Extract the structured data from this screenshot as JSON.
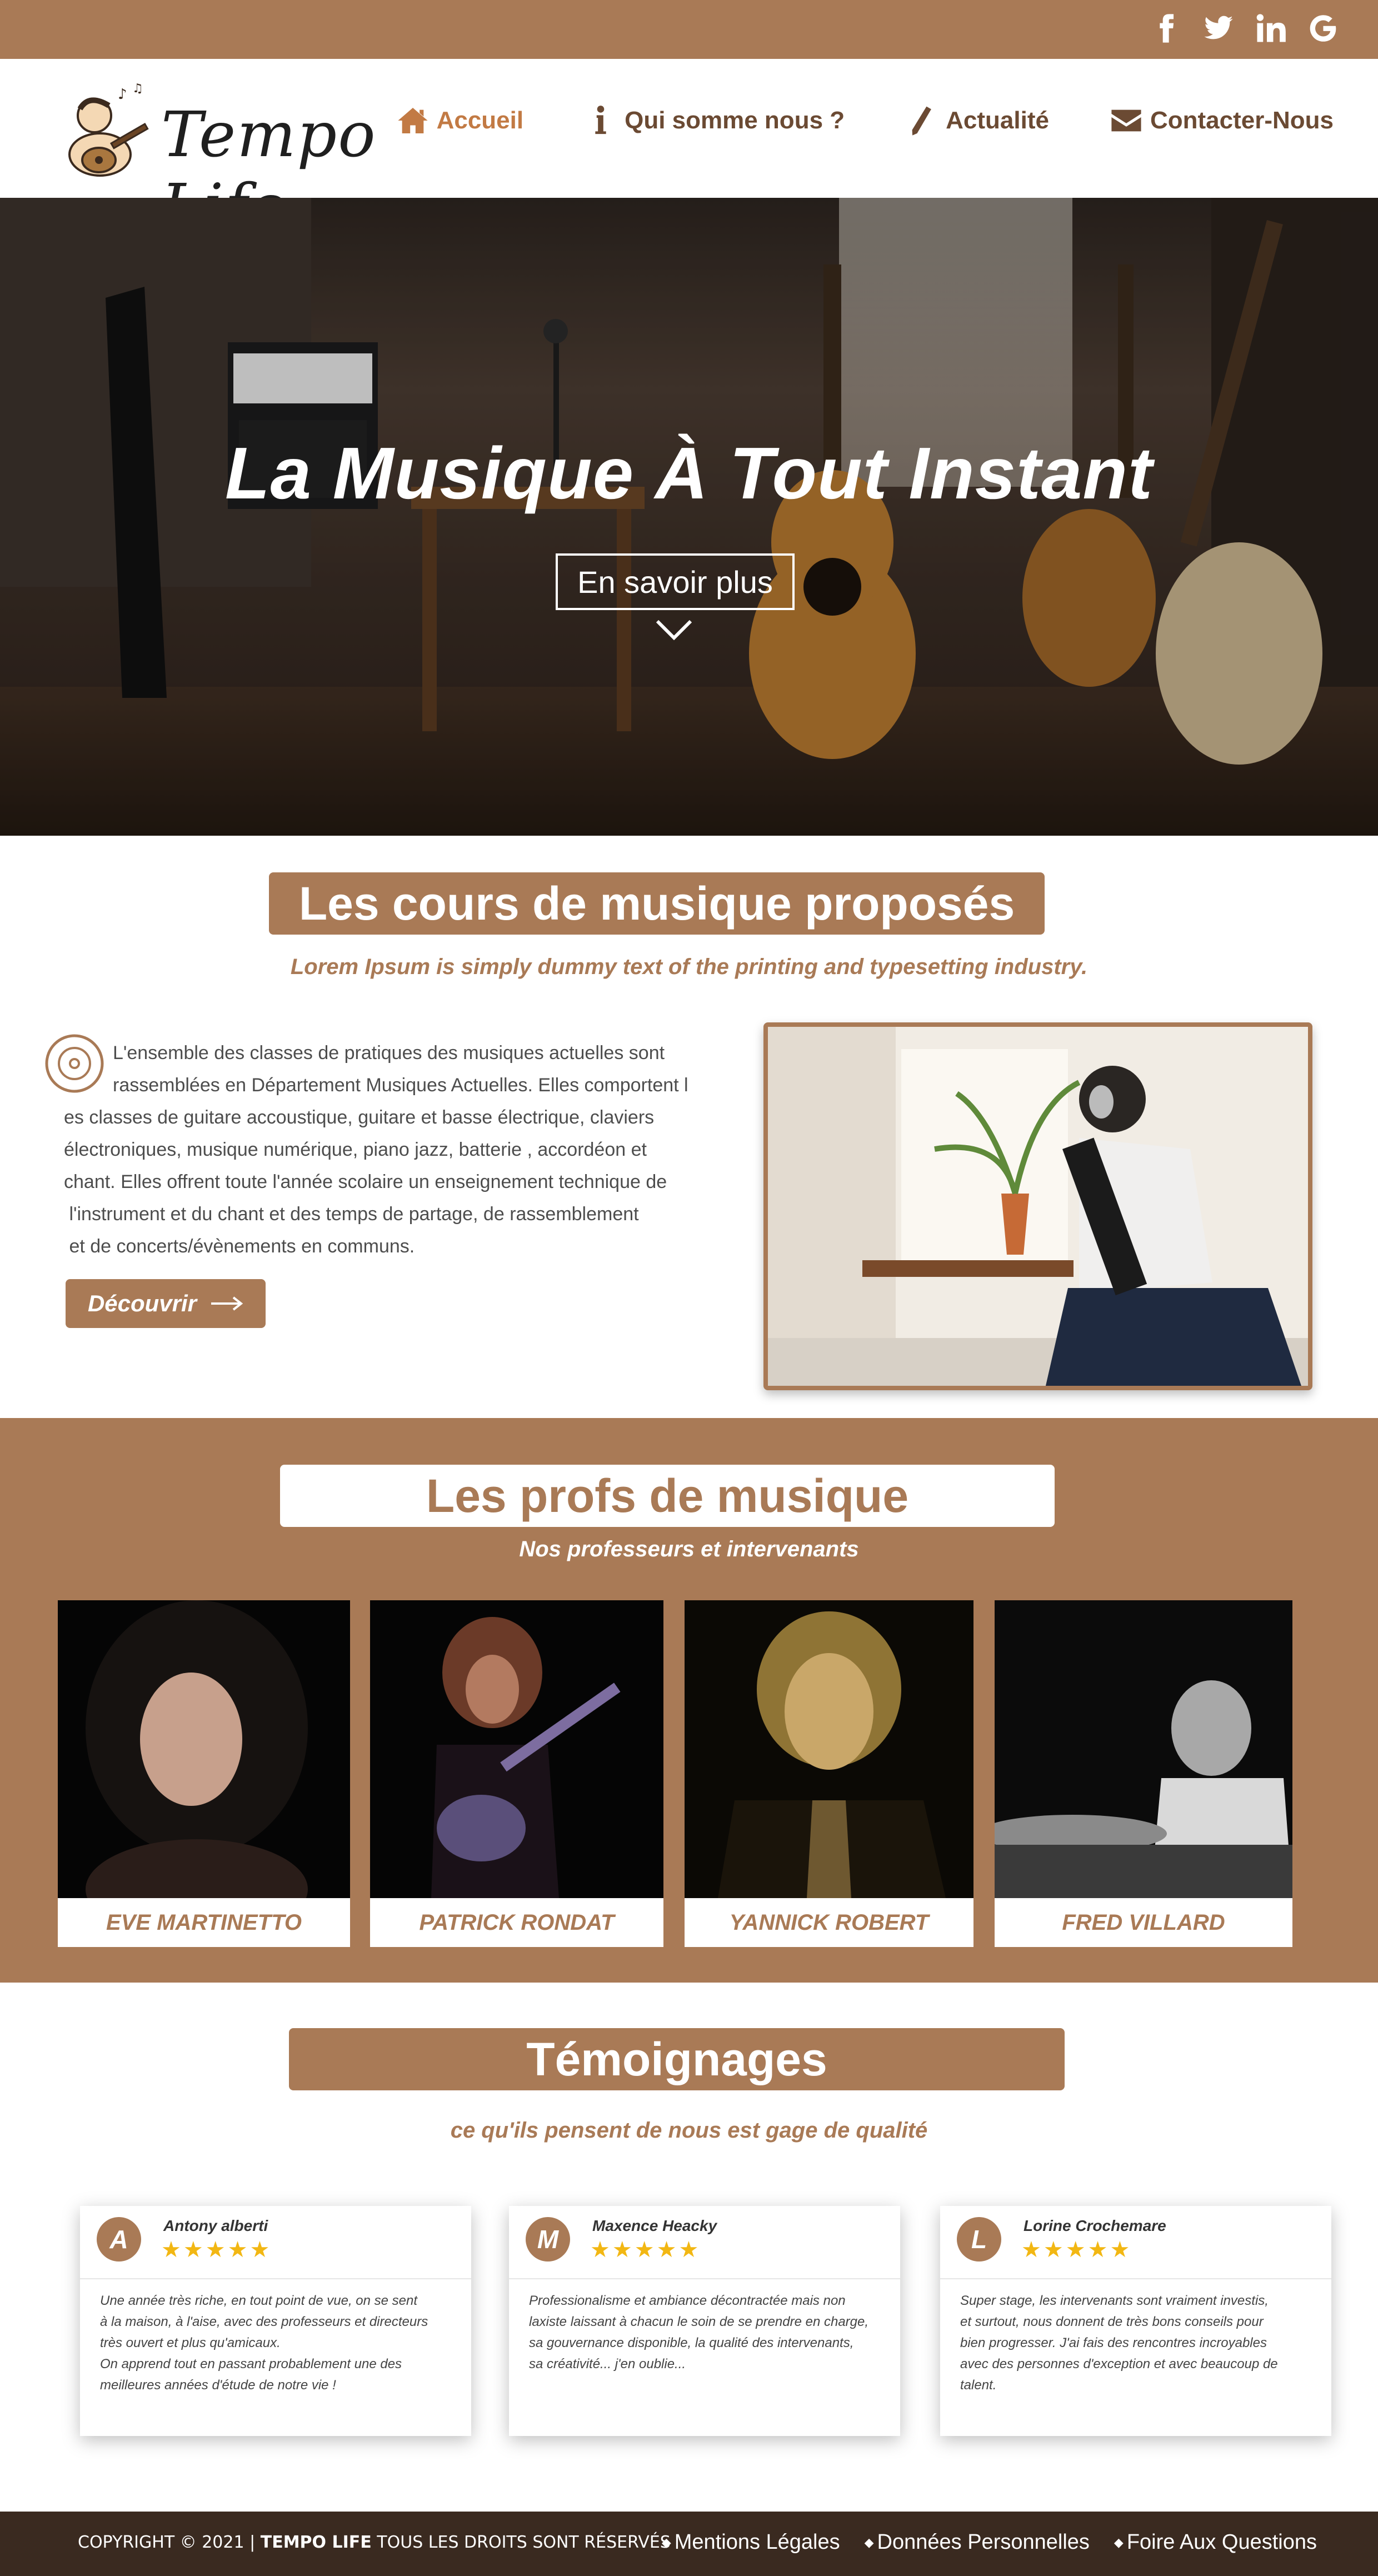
{
  "social": {
    "icons": [
      "facebook-icon",
      "twitter-icon",
      "linkedin-icon",
      "google-icon"
    ]
  },
  "brand": {
    "name": "Tempo Life",
    "color": "#a97a56",
    "dark": "#3a2a20",
    "nav_active_color": "#c27a44"
  },
  "nav": {
    "items": [
      {
        "label": "Accueil",
        "icon": "home-icon"
      },
      {
        "label": "Qui somme nous ?",
        "icon": "info-icon"
      },
      {
        "label": "Actualité",
        "icon": "pencil-icon"
      },
      {
        "label": "Contacter-Nous",
        "icon": "envelope-icon"
      }
    ]
  },
  "hero": {
    "title": "La Musique À Tout Instant",
    "button": "En savoir plus"
  },
  "cours": {
    "title": "Les cours de musique proposés",
    "subtitle": "Lorem Ipsum is simply dummy text of the printing and typesetting industry.",
    "lines": [
      "L'ensemble des classes de pratiques des musiques actuelles sont",
      "rassemblées en Département Musiques Actuelles. Elles comportent l",
      "es classes de guitare accoustique, guitare et basse électrique, claviers",
      "électroniques, musique numérique, piano jazz, batterie , accordéon et",
      "chant. Elles offrent toute l'année scolaire un enseignement technique de",
      " l'instrument et du chant et des temps de partage, de rassemblement",
      " et de concerts/évènements en communs."
    ],
    "button": "Découvrir"
  },
  "profs": {
    "title": "Les profs de musique",
    "subtitle": "Nos professeurs et intervenants",
    "cards": [
      {
        "name": "EVE MARTINETTO"
      },
      {
        "name": "PATRICK RONDAT"
      },
      {
        "name": "YANNICK ROBERT"
      },
      {
        "name": "FRED VILLARD"
      }
    ]
  },
  "temoignages": {
    "title": "Témoignages",
    "subtitle": "ce qu'ils pensent de nous est gage de qualité",
    "items": [
      {
        "initial": "A",
        "name": "Antony alberti",
        "stars": "★★★★★",
        "rating": 5,
        "text": "Une année très riche, en tout point de vue, on se sent\nà la maison, à l'aise, avec des professeurs et directeurs\ntrès ouvert et plus qu'amicaux.\nOn apprend tout en passant probablement une des\n meilleures années d'étude de notre vie !"
      },
      {
        "initial": "M",
        "name": "Maxence Heacky",
        "stars": "★★★★★",
        "rating": 5,
        "text": "Professionalisme et ambiance décontractée mais non\nlaxiste laissant à chacun le soin de se prendre en charge,\nsa gouvernance disponible, la qualité des intervenants,\nsa créativité... j'en oublie..."
      },
      {
        "initial": "L",
        "name": "Lorine Crochemare",
        "stars": "★★★★★",
        "rating": 5,
        "text": "Super stage, les intervenants sont vraiment investis,\net surtout, nous donnent de très bons conseils pour\nbien progresser. J'ai fais des rencontres incroyables\navec des personnes d'exception et avec beaucoup de\n talent."
      }
    ]
  },
  "footer": {
    "copyright_prefix": "COPYRIGHT © 2021 | ",
    "copyright_brand": "TEMPO LIFE",
    "copyright_suffix": " TOUS LES DROITS SONT RÉSERVÉS",
    "links": [
      "Mentions Légales",
      "Données Personnelles",
      "Foire Aux Questions"
    ]
  }
}
